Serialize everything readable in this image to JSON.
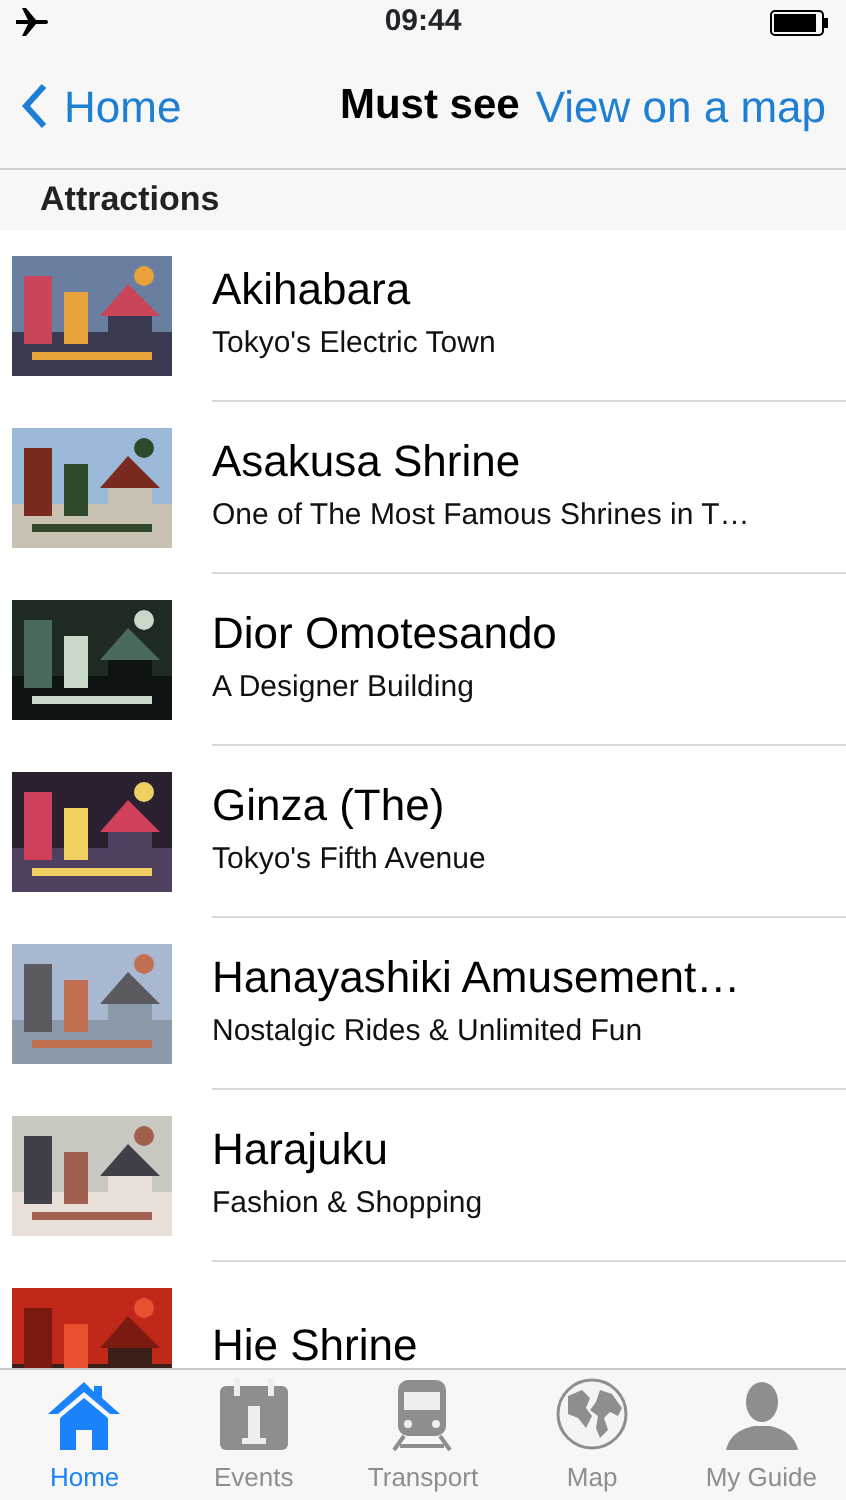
{
  "status_bar": {
    "time": "09:44",
    "airplane_mode": true
  },
  "nav_bar": {
    "back": "Home",
    "title": "Must see",
    "action": "View on a map"
  },
  "section": {
    "title": "Attractions"
  },
  "items": [
    {
      "title": "Akihabara",
      "subtitle": "Tokyo's Electric Town",
      "kind": "picture"
    },
    {
      "title": "Asakusa Shrine",
      "subtitle": "One of The Most Famous Shrines in T…",
      "kind": "picture"
    },
    {
      "title": "Dior Omotesando",
      "subtitle": "A Designer Building",
      "kind": "picture"
    },
    {
      "title": "Ginza (The)",
      "subtitle": "Tokyo's Fifth Avenue",
      "kind": "picture"
    },
    {
      "title": "Hanayashiki Amusement…",
      "subtitle": "Nostalgic Rides & Unlimited Fun",
      "kind": "picture"
    },
    {
      "title": "Harajuku",
      "subtitle": "Fashion & Shopping",
      "kind": "picture"
    },
    {
      "title": "Hie Shrine",
      "kind": "picture"
    }
  ],
  "tab_bar": [
    {
      "label": "Home",
      "kind": "home",
      "selected": true
    },
    {
      "label": "Events",
      "kind": "calendar",
      "selected": false
    },
    {
      "label": "Transport",
      "kind": "train",
      "selected": false
    },
    {
      "label": "Map",
      "kind": "globe",
      "selected": false
    },
    {
      "label": "My Guide",
      "kind": "person",
      "selected": false
    }
  ]
}
